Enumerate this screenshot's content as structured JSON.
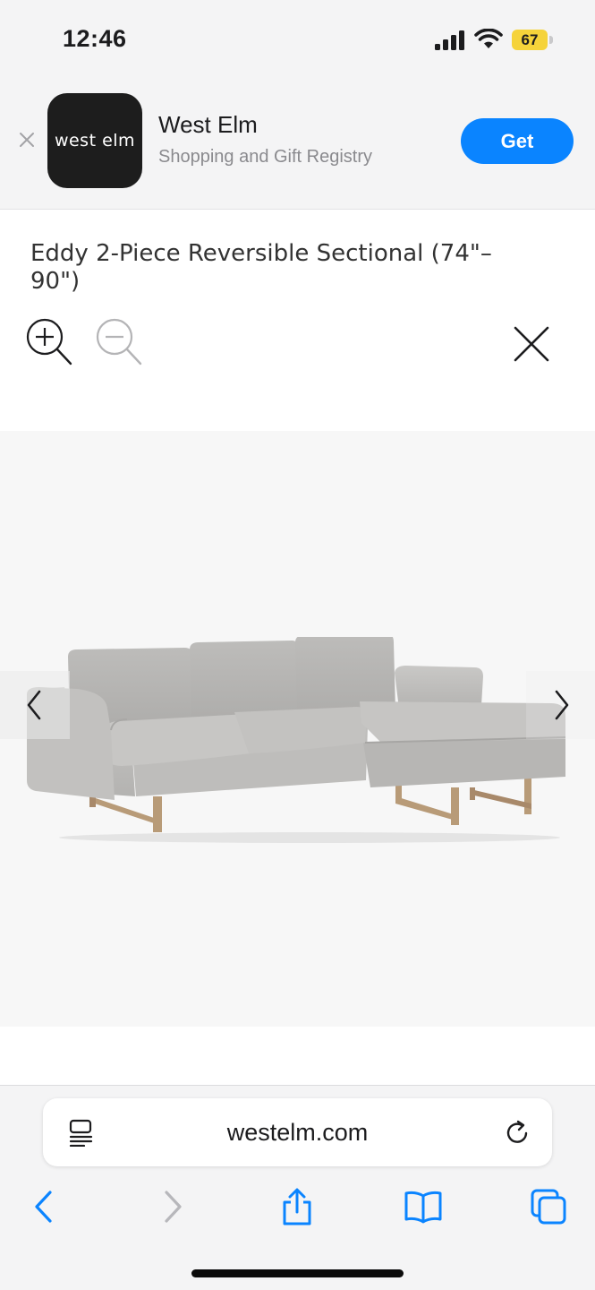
{
  "status_bar": {
    "time": "12:46",
    "battery": "67",
    "battery_color": "#f5d33a"
  },
  "app_banner": {
    "icon_text": "west elm",
    "app_name": "West Elm",
    "subtitle": "Shopping and Gift Registry",
    "get_label": "Get",
    "get_color": "#0a84ff"
  },
  "product": {
    "title": "Eddy 2-Piece Reversible Sectional (74\"–90\")"
  },
  "viewer": {
    "icons": [
      "zoom-in-icon",
      "zoom-out-icon",
      "close-icon",
      "chevron-left-icon",
      "chevron-right-icon"
    ],
    "background_color": "#f7f7f7"
  },
  "browser": {
    "url": "westelm.com",
    "accent_color": "#0a84ff",
    "toolbar_icons": [
      "back-icon",
      "forward-icon",
      "share-icon",
      "bookmarks-icon",
      "tabs-icon"
    ]
  }
}
